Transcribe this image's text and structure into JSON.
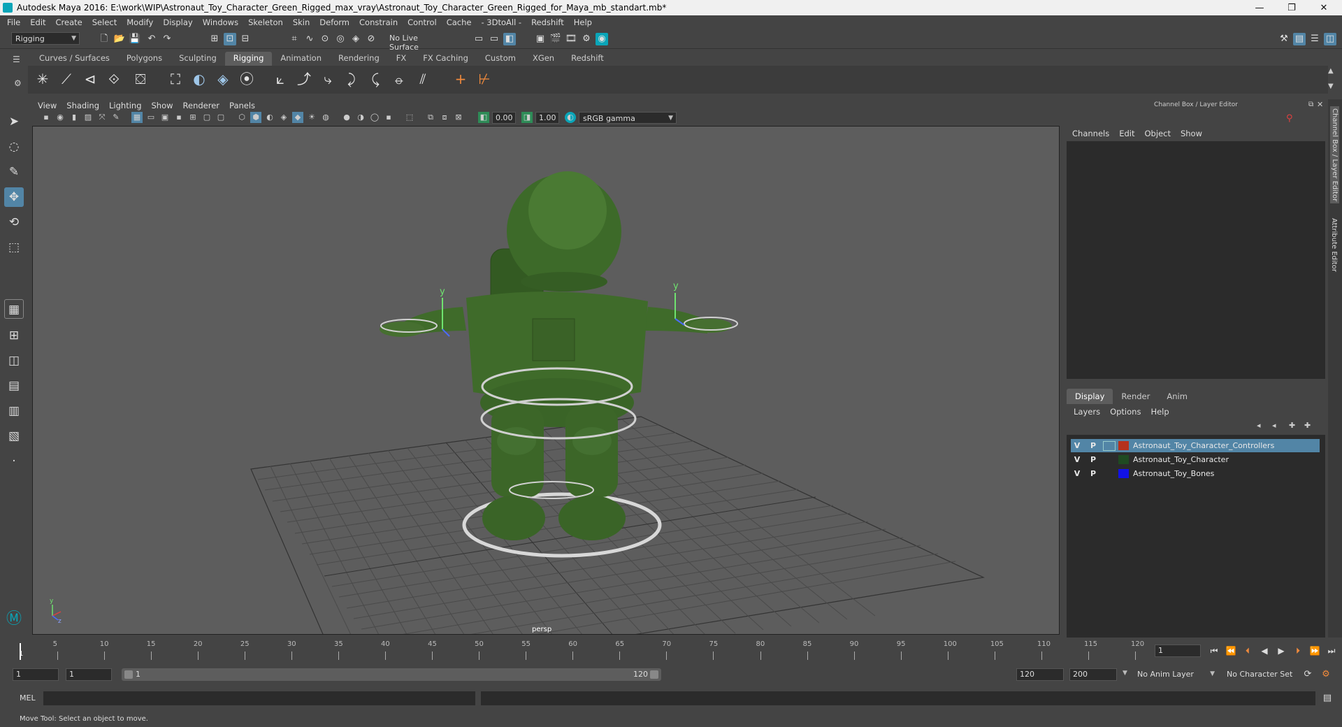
{
  "window": {
    "title": "Autodesk Maya 2016: E:\\work\\WIP\\Astronaut_Toy_Character_Green_Rigged_max_vray\\Astronaut_Toy_Character_Green_Rigged_for_Maya_mb_standart.mb*"
  },
  "menubar": [
    "File",
    "Edit",
    "Create",
    "Select",
    "Modify",
    "Display",
    "Windows",
    "Skeleton",
    "Skin",
    "Deform",
    "Constrain",
    "Control",
    "Cache",
    "- 3DtoAll -",
    "Redshift",
    "Help"
  ],
  "statusline": {
    "mode": "Rigging",
    "live_surface": "No Live Surface"
  },
  "shelf_tabs": [
    "Curves / Surfaces",
    "Polygons",
    "Sculpting",
    "Rigging",
    "Animation",
    "Rendering",
    "FX",
    "FX Caching",
    "Custom",
    "XGen",
    "Redshift"
  ],
  "active_shelf": "Rigging",
  "viewport": {
    "menus": [
      "View",
      "Shading",
      "Lighting",
      "Show",
      "Renderer",
      "Panels"
    ],
    "exposure": "0.00",
    "gamma": "1.00",
    "color_space": "sRGB gamma",
    "camera_label": "persp",
    "axis_y": "y",
    "axis_z": "z"
  },
  "channel_box": {
    "header": "Channel Box / Layer Editor",
    "menus": [
      "Channels",
      "Edit",
      "Object",
      "Show"
    ]
  },
  "layer_editor": {
    "tabs": [
      "Display",
      "Render",
      "Anim"
    ],
    "active_tab": "Display",
    "menus": [
      "Layers",
      "Options",
      "Help"
    ],
    "layers": [
      {
        "v": "V",
        "p": "P",
        "name": "Astronaut_Toy_Character_Controllers",
        "color": "#b5321d",
        "selected": true
      },
      {
        "v": "V",
        "p": "P",
        "name": "Astronaut_Toy_Character",
        "color": "#1f4a22",
        "selected": false
      },
      {
        "v": "V",
        "p": "P",
        "name": "Astronaut_Toy_Bones",
        "color": "#1212e6",
        "selected": false
      }
    ]
  },
  "side_tabs": [
    "Channel Box / Layer Editor",
    "Attribute Editor"
  ],
  "timeline": {
    "ticks": [
      "5",
      "10",
      "15",
      "20",
      "25",
      "30",
      "35",
      "40",
      "45",
      "50",
      "55",
      "60",
      "65",
      "70",
      "75",
      "80",
      "85",
      "90",
      "95",
      "100",
      "105",
      "110",
      "115",
      "120"
    ],
    "current_frame": "1",
    "start_label": "1"
  },
  "range": {
    "start": "1",
    "playback_start": "1",
    "slider_start": "1",
    "slider_end": "120",
    "playback_end": "120",
    "end": "200",
    "anim_layer": "No Anim Layer",
    "character_set": "No Character Set"
  },
  "cmdline": {
    "label": "MEL"
  },
  "help_line": "Move Tool: Select an object to move.",
  "colors": {
    "accent_selection": "#5285a6",
    "viewport_bg": "#5d5d5d",
    "model_green": "#3f6b2a"
  }
}
